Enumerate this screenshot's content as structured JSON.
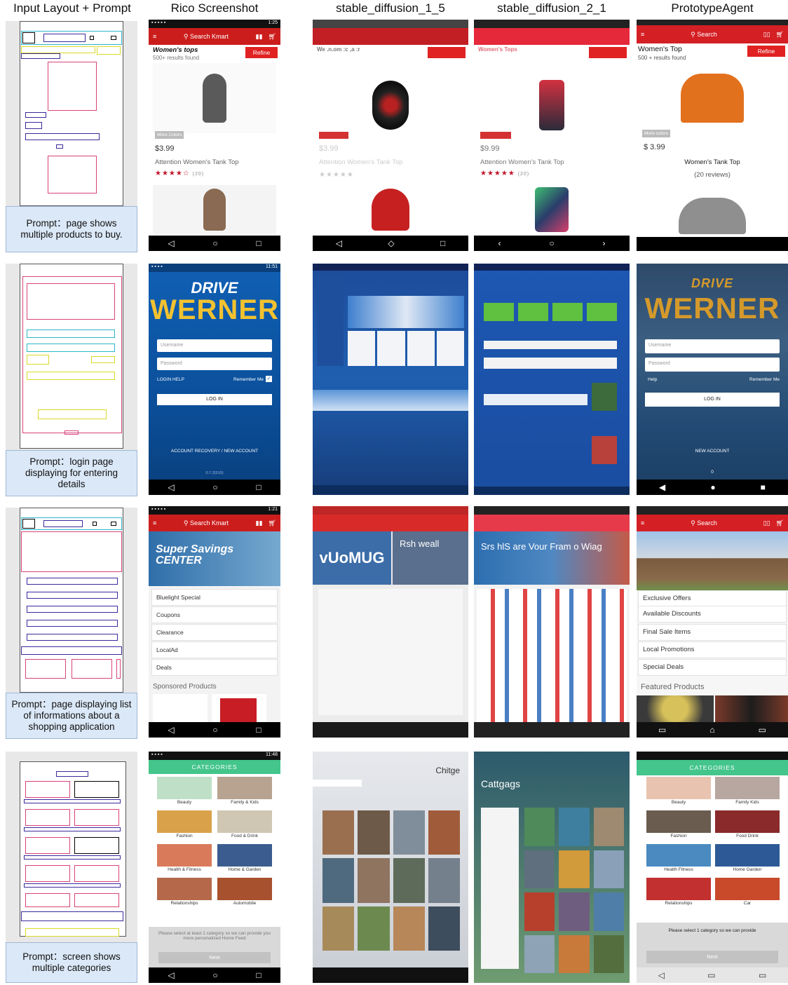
{
  "columns": [
    "Input Layout + Prompt",
    "Rico Screenshot",
    "stable_diffusion_1_5",
    "stable_diffusion_2_1",
    "PrototypeAgent"
  ],
  "prompts": [
    "Prompt：page shows multiple products to buy.",
    "Prompt：login page displaying for entering details",
    "Prompt：page displaying list of informations about a shopping application",
    "Prompt：screen shows multiple categories"
  ],
  "row1": {
    "rico": {
      "search": "Search Kmart",
      "title": "Women's tops",
      "sub": "500+ results found",
      "refine": "Refine",
      "more": "More Colors",
      "price": "$3.99",
      "name": "Attention Women's Tank Top",
      "stars": "★★★★☆",
      "reviews": "(20)",
      "status_time": "1:25"
    },
    "sd15": {
      "title": "We  .n.om :c  ,a :r",
      "price": "$3.99",
      "name": "Attention Women's Tank Top"
    },
    "sd21": {
      "title": "Women's Tops",
      "price": "$9.99",
      "name": "Attention Women's Tank Top",
      "reviews": "(20)"
    },
    "agent": {
      "search": "Search",
      "title": "Women's Top",
      "sub": "500 + results found",
      "refine": "Refine",
      "more": "More colors",
      "price": "$ 3.99",
      "name": "Women's Tank Top",
      "reviews": "(20 reviews)"
    }
  },
  "row2": {
    "rico": {
      "drive": "DRIVE",
      "werner": "WERNER",
      "username": "Username",
      "password": "Password",
      "help": "LOGIN HELP",
      "remember": "Remember Me",
      "login": "LOG IN",
      "recovery": "ACCOUNT RECOVERY / NEW ACCOUNT",
      "version": "0.7.2(510)",
      "status_time": "11:51"
    },
    "agent": {
      "drive": "DRIVE",
      "werner": "WERNER",
      "username": "Username",
      "password": "Password",
      "help": "Help",
      "remember": "Remember Me",
      "login": "LOG IN",
      "new_account": "NEW ACCOUNT",
      "version": "0"
    }
  },
  "row3": {
    "rico": {
      "search": "Search Kmart",
      "banner": "Super Savings CENTER",
      "items": [
        "Bluelight Special",
        "Coupons",
        "Clearance",
        "LocalAd",
        "Deals"
      ],
      "sponsored": "Sponsored Products",
      "status_time": "1:21"
    },
    "sd15": {
      "banner": "vUoMUG",
      "side": "Rsh weall"
    },
    "sd21": {
      "banner": "Srs hlS are Vour Fram o Wiag"
    },
    "agent": {
      "search": "Search",
      "items": [
        "Exclusive Offers",
        "Available Discounts",
        "Final Sale Items",
        "Local Promotions",
        "Special Deals"
      ],
      "featured": "Featured Products"
    }
  },
  "row4": {
    "rico": {
      "header": "CATEGORIES",
      "tiles": [
        "Beauty",
        "Family & Kids",
        "Fashion",
        "Food & Drink",
        "Health & Fitness",
        "Home & Garden",
        "Relationships",
        "Automobile"
      ],
      "msg": "Please select at least 1 category so we can provide you more personalized Home Feed",
      "next": "Next",
      "status_time": "11:48"
    },
    "sd15": {
      "title": "Chitge"
    },
    "sd21": {
      "title": "Cattgags"
    },
    "agent": {
      "header": "CATEGORIES",
      "tiles": [
        "Beauty",
        "Family Kids",
        "Fashion",
        "Food Drink",
        "Health Fitness",
        "Home Garden",
        "Relationships",
        "Car"
      ],
      "msg": "Please select 1 category so we can provide",
      "next": "Next"
    }
  }
}
